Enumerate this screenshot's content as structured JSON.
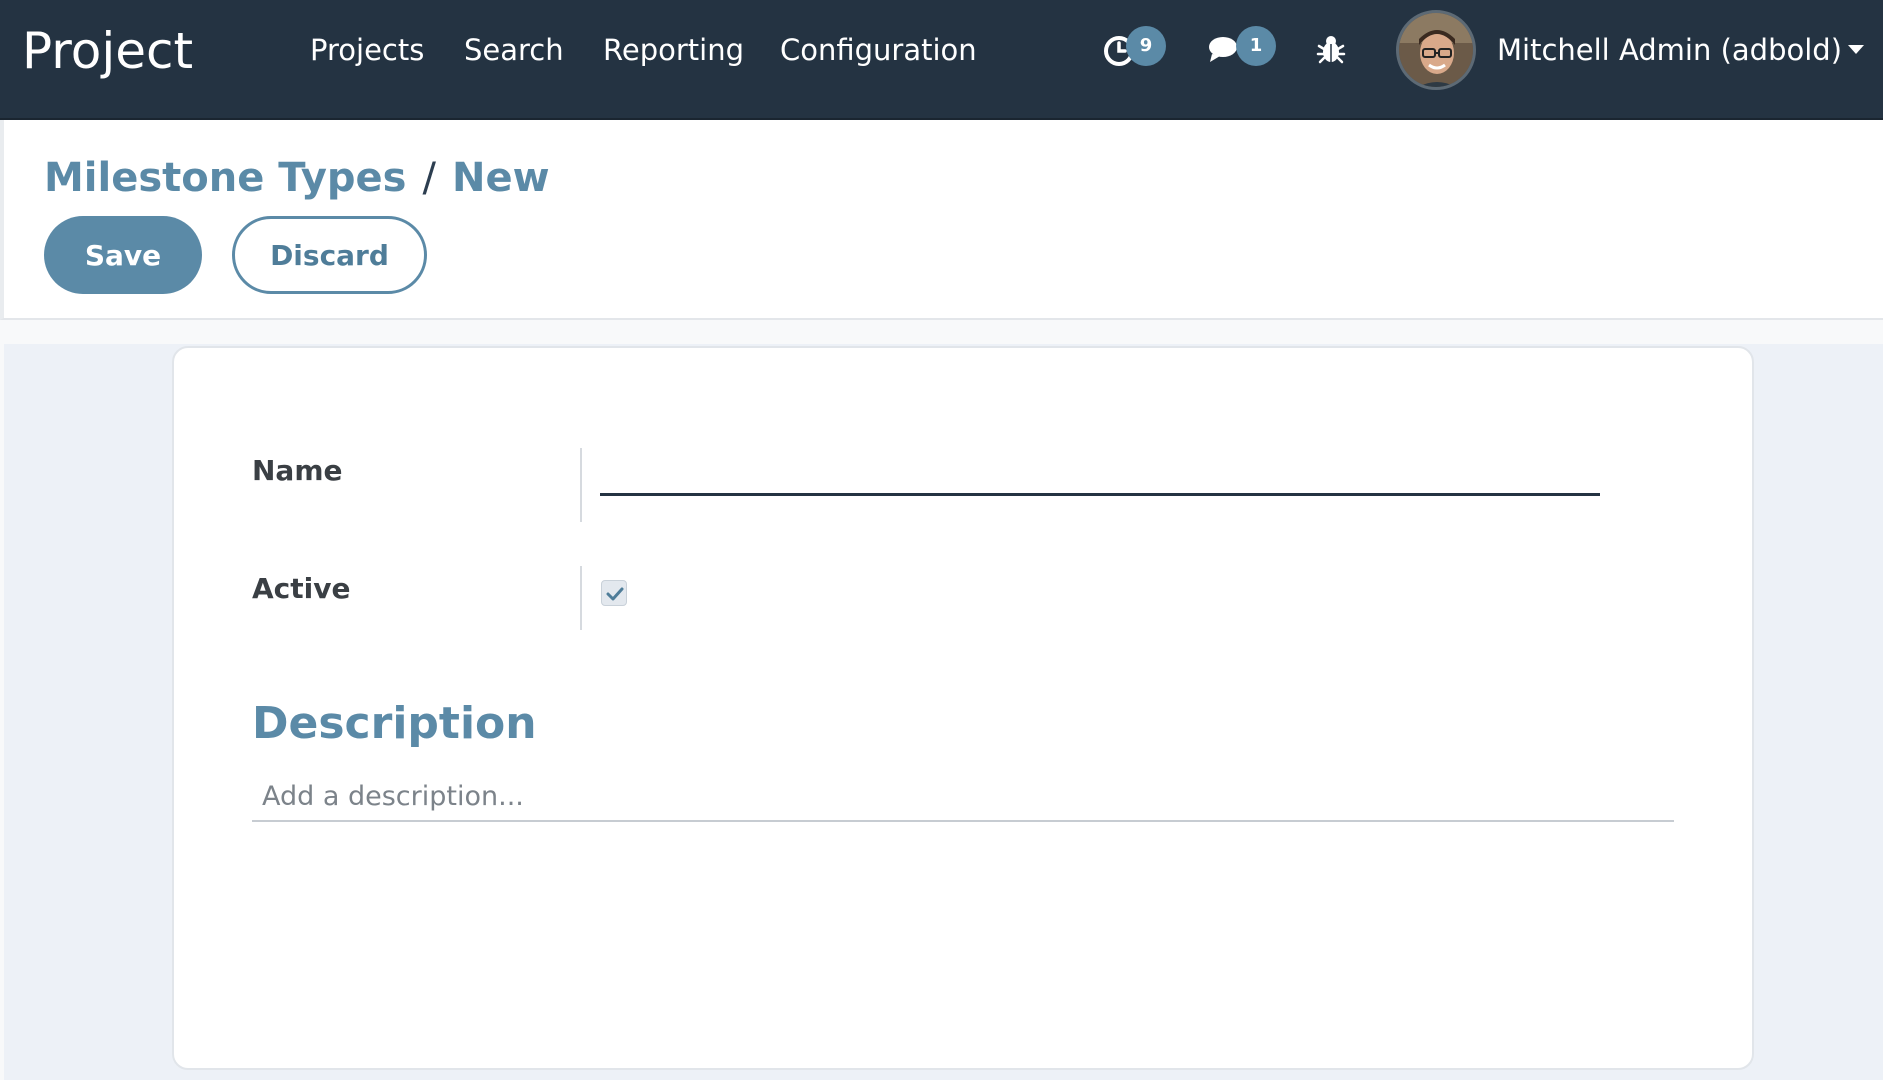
{
  "navbar": {
    "brand": "Project",
    "menu": [
      {
        "label": "Projects"
      },
      {
        "label": "Search"
      },
      {
        "label": "Reporting"
      },
      {
        "label": "Configuration"
      }
    ],
    "activity": {
      "icon": "clock-icon",
      "count": "9"
    },
    "messages": {
      "icon": "chat-icon",
      "count": "1"
    },
    "debug": {
      "icon": "bug-icon"
    },
    "user": {
      "name": "Mitchell Admin (adbold)"
    }
  },
  "breadcrumb": {
    "parent": "Milestone Types",
    "separator": "/",
    "current": "New"
  },
  "actions": {
    "save_label": "Save",
    "discard_label": "Discard"
  },
  "form": {
    "name_label": "Name",
    "name_value": "",
    "active_label": "Active",
    "active_checked": true,
    "description_title": "Description",
    "description_placeholder": "Add a description..."
  },
  "colors": {
    "navbar": "#243342",
    "accent": "#5b8aa7"
  }
}
